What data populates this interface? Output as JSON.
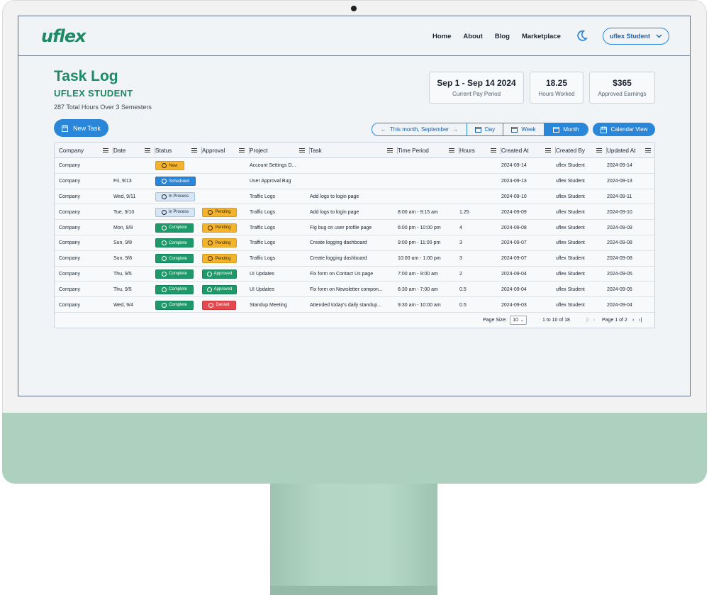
{
  "nav": {
    "logo": "uflex",
    "links": [
      "Home",
      "About",
      "Blog",
      "Marketplace"
    ],
    "user": "uflex Student"
  },
  "header": {
    "title": "Task Log",
    "subtitle": "UFLEX STUDENT",
    "summary": "287 Total Hours Over 3 Semesters"
  },
  "cards": [
    {
      "value": "Sep 1 - Sep 14 2024",
      "label": "Current Pay Period"
    },
    {
      "value": "18.25",
      "label": "Hours Worked"
    },
    {
      "value": "$365",
      "label": "Approved Earnings"
    }
  ],
  "toolbar": {
    "new_task": "New Task",
    "period": "This month, September",
    "day": "Day",
    "week": "Week",
    "month": "Month",
    "calendar_view": "Calendar View"
  },
  "columns": [
    "Company",
    "Date",
    "Status",
    "Approval",
    "Project",
    "Task",
    "Time Period",
    "Hours",
    "Created At",
    "Created By",
    "Updated At"
  ],
  "rows": [
    {
      "company": "Company",
      "date": "",
      "status": "New",
      "approval": "",
      "project": "Account Settings D...",
      "task": "",
      "time": "",
      "hours": "",
      "created": "2024-09-14",
      "by": "uflex Student",
      "updated": "2024-09-14"
    },
    {
      "company": "Company",
      "date": "Fri, 9/13",
      "status": "Scheduled",
      "approval": "",
      "project": "User Approval Bug",
      "task": "",
      "time": "",
      "hours": "",
      "created": "2024-09-13",
      "by": "uflex Student",
      "updated": "2024-09-13"
    },
    {
      "company": "Company",
      "date": "Wed, 9/11",
      "status": "In Process",
      "approval": "",
      "project": "Traffic Logs",
      "task": "Add logs to login page",
      "time": "",
      "hours": "",
      "created": "2024-09-10",
      "by": "uflex Student",
      "updated": "2024-09-11"
    },
    {
      "company": "Company",
      "date": "Tue, 9/10",
      "status": "In Process",
      "approval": "Pending",
      "project": "Traffic Logs",
      "task": "Add logs to login page",
      "time": "8:00 am - 9:15 am",
      "hours": "1.25",
      "created": "2024-09-09",
      "by": "uflex Student",
      "updated": "2024-09-10"
    },
    {
      "company": "Company",
      "date": "Mon, 9/9",
      "status": "Complete",
      "approval": "Pending",
      "project": "Traffic Logs",
      "task": "Fig bug on user profile page",
      "time": "6:00 pm - 10:00 pm",
      "hours": "4",
      "created": "2024-09-08",
      "by": "uflex Student",
      "updated": "2024-09-09"
    },
    {
      "company": "Company",
      "date": "Sun, 9/8",
      "status": "Complete",
      "approval": "Pending",
      "project": "Traffic Logs",
      "task": "Create logging dashboard",
      "time": "9:00 pm - 11:00 pm",
      "hours": "3",
      "created": "2024-09-07",
      "by": "uflex Student",
      "updated": "2024-09-08"
    },
    {
      "company": "Company",
      "date": "Sun, 9/8",
      "status": "Complete",
      "approval": "Pending",
      "project": "Traffic Logs",
      "task": "Create logging dashboard",
      "time": "10:00 am - 1:00 pm",
      "hours": "3",
      "created": "2024-09-07",
      "by": "uflex Student",
      "updated": "2024-09-08"
    },
    {
      "company": "Company",
      "date": "Thu, 9/5",
      "status": "Complete",
      "approval": "Approved",
      "project": "UI Updates",
      "task": "Fix form on Contact Us page",
      "time": "7:00 am - 9:00 am",
      "hours": "2",
      "created": "2024-09-04",
      "by": "uflex Student",
      "updated": "2024-09-05"
    },
    {
      "company": "Company",
      "date": "Thu, 9/5",
      "status": "Complete",
      "approval": "Approved",
      "project": "UI Updates",
      "task": "Fix form on Newsletter compon...",
      "time": "6:30 am - 7:00 am",
      "hours": "0.5",
      "created": "2024-09-04",
      "by": "uflex Student",
      "updated": "2024-09-05"
    },
    {
      "company": "Company",
      "date": "Wed, 9/4",
      "status": "Complete",
      "approval": "Denied",
      "project": "Standup Meeting",
      "task": "Attended today's daily standup...",
      "time": "9:30 am - 10:00 am",
      "hours": "0.5",
      "created": "2024-09-03",
      "by": "uflex Student",
      "updated": "2024-09-04"
    }
  ],
  "footer": {
    "page_size_label": "Page Size:",
    "page_size": "10",
    "range": "1 to 10 of 18",
    "page": "Page 1 of 2"
  },
  "colors": {
    "brand_green": "#1d8a63",
    "accent_blue": "#2a86d8",
    "pending": "#f3b32d",
    "complete": "#1e9a6a",
    "denied": "#e5484d"
  }
}
